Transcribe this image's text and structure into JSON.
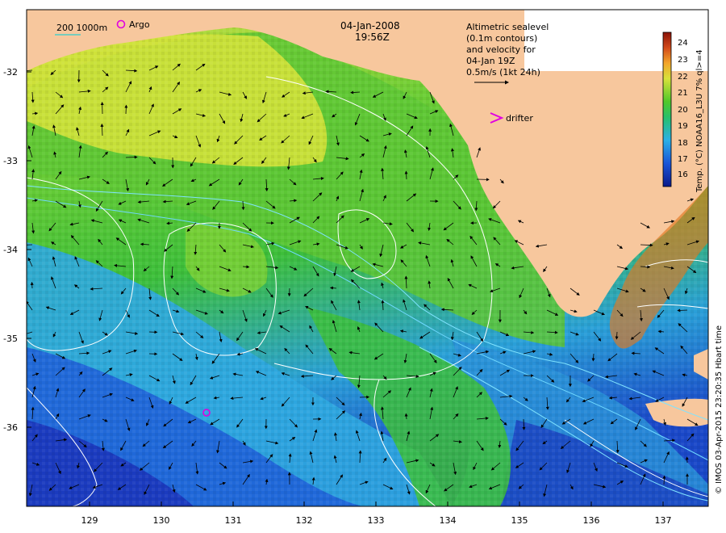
{
  "map": {
    "datetime_line1": "04-Jan-2008",
    "datetime_line2": "19:56Z",
    "scale_label": "200  1000m",
    "argo_label": "Argo",
    "drifter_label": "drifter",
    "info_lines": [
      "Altimetric sealevel",
      "(0.1m contours)",
      "and velocity for",
      "04-Jan 19Z",
      "0.5m/s (1kt 24h)"
    ],
    "lat_ticks": [
      "-32",
      "-33",
      "-34",
      "-35",
      "-36"
    ],
    "lon_ticks": [
      "129",
      "130",
      "131",
      "132",
      "133",
      "134",
      "135",
      "136",
      "137"
    ],
    "colorbar": {
      "ticks": [
        "24",
        "23",
        "22",
        "21",
        "20",
        "19",
        "18",
        "17",
        "16"
      ],
      "label": "Temp. (°C) NOAA16_L3U 7% ql>=4"
    },
    "credit": "© IMOS 03-Apr-2015 23:20:35 Hbart time",
    "colors": {
      "land": "#f7c79d",
      "warm": "#e8e83a",
      "mid": "#3fbf38",
      "cool": "#2aa8e0",
      "cold": "#1a3cc9"
    }
  }
}
